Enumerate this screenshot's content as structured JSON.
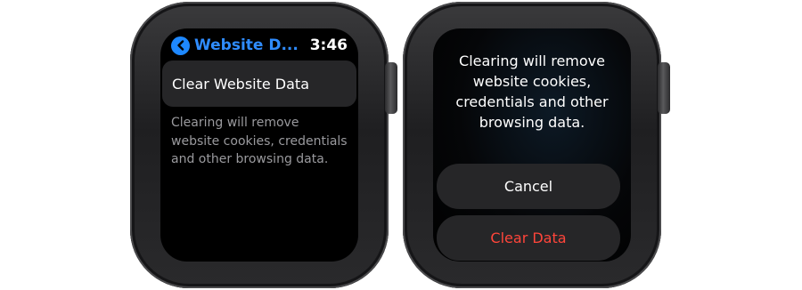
{
  "left_screen": {
    "nav_title": "Website D...",
    "time": "3:46",
    "clear_item_label": "Clear Website Data",
    "footnote": "Clearing will remove website cookies, credentials and other browsing data.",
    "back_icon": "chevron-left-icon"
  },
  "right_screen": {
    "message": "Clearing will remove website cookies, credentials and other browsing data.",
    "cancel_label": "Cancel",
    "clear_label": "Clear Data"
  },
  "colors": {
    "accent_blue": "#1e88ff",
    "destructive_red": "#ff453a",
    "cell_background": "#262628",
    "secondary_text": "#9a9a9e"
  }
}
